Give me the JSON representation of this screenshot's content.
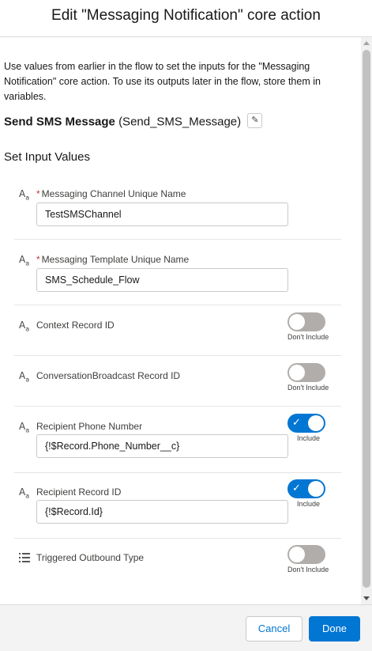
{
  "header": {
    "title": "Edit \"Messaging Notification\" core action"
  },
  "intro": "Use values from earlier in the flow to set the inputs for the \"Messaging Notification\" core action. To use its outputs later in the flow, store them in variables.",
  "action": {
    "label": "Send SMS Message",
    "api_name": "(Send_SMS_Message)"
  },
  "section_title": "Set Input Values",
  "type_icon_text": {
    "main": "A",
    "sub": "a"
  },
  "fields": [
    {
      "label": "Messaging Channel Unique Name",
      "required": "*",
      "value": "TestSMSChannel"
    },
    {
      "label": "Messaging Template Unique Name",
      "required": "*",
      "value": "SMS_Schedule_Flow"
    },
    {
      "label": "Context Record ID",
      "toggle": "off",
      "toggle_caption": "Don't Include"
    },
    {
      "label": "ConversationBroadcast Record ID",
      "toggle": "off",
      "toggle_caption": "Don't Include"
    },
    {
      "label": "Recipient Phone Number",
      "toggle": "on",
      "toggle_caption": "Include",
      "value": "{!$Record.Phone_Number__c}"
    },
    {
      "label": "Recipient Record ID",
      "toggle": "on",
      "toggle_caption": "Include",
      "value": "{!$Record.Id}"
    },
    {
      "label": "Triggered Outbound Type",
      "toggle": "off",
      "toggle_caption": "Don't Include",
      "icon": "list-icon"
    }
  ],
  "footer": {
    "cancel_label": "Cancel",
    "done_label": "Done"
  },
  "colors": {
    "brand": "#0176d3",
    "toggle_off": "#b0adab",
    "required": "#c23934"
  }
}
